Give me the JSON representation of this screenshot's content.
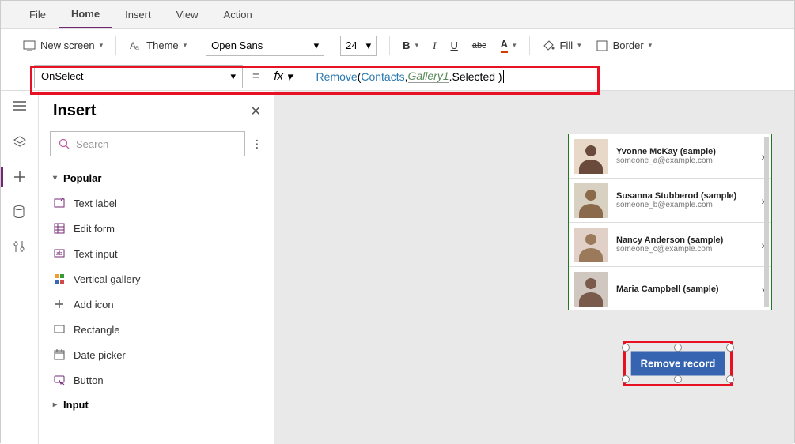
{
  "menu": {
    "items": [
      "File",
      "Home",
      "Insert",
      "View",
      "Action"
    ],
    "active": "Home"
  },
  "ribbon": {
    "new_screen": "New screen",
    "theme": "Theme",
    "font": "Open Sans",
    "size": "24",
    "fill": "Fill",
    "border": "Border"
  },
  "formula": {
    "property": "OnSelect",
    "fx_label": "fx",
    "expr": {
      "fn": "Remove",
      "lp": "( ",
      "arg1": "Contacts",
      "comma": ", ",
      "gal": "Gallery1",
      "tail": ".Selected )"
    }
  },
  "insert": {
    "title": "Insert",
    "search_placeholder": "Search",
    "cat_popular": "Popular",
    "items": [
      "Text label",
      "Edit form",
      "Text input",
      "Vertical gallery",
      "Add icon",
      "Rectangle",
      "Date picker",
      "Button"
    ],
    "cat_input": "Input"
  },
  "gallery": {
    "items": [
      {
        "name": "Yvonne McKay (sample)",
        "email": "someone_a@example.com"
      },
      {
        "name": "Susanna Stubberod (sample)",
        "email": "someone_b@example.com"
      },
      {
        "name": "Nancy Anderson (sample)",
        "email": "someone_c@example.com"
      },
      {
        "name": "Maria Campbell (sample)",
        "email": ""
      }
    ]
  },
  "button": {
    "label": "Remove record"
  }
}
